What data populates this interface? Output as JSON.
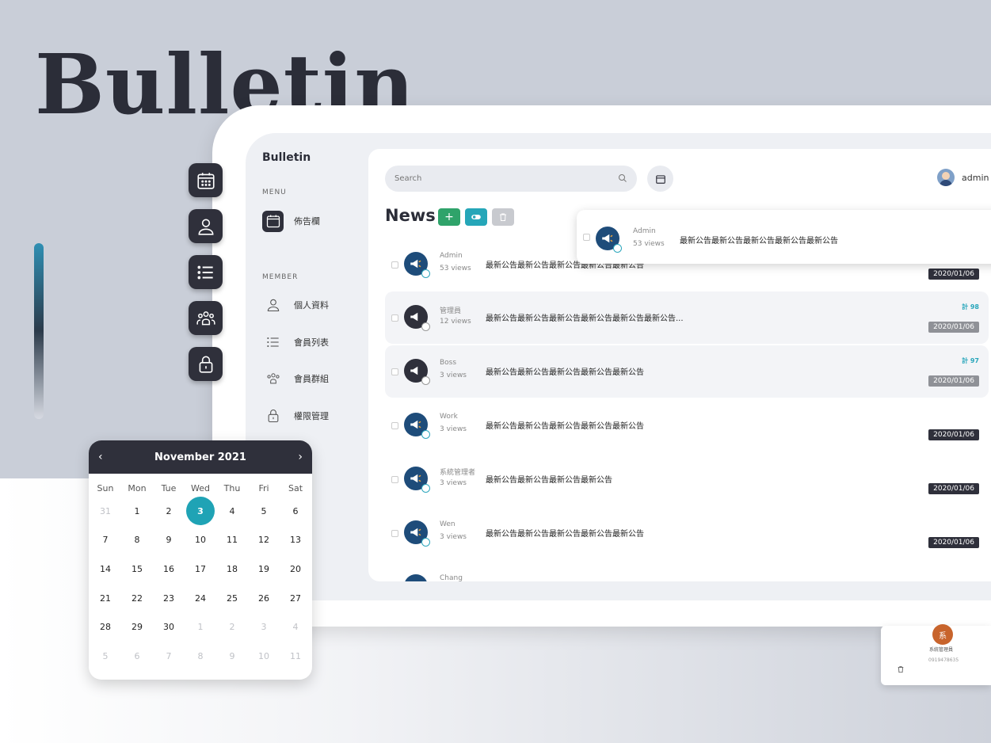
{
  "hero": {
    "title": "Bulletin"
  },
  "sidebar": {
    "brand": "Bulletin",
    "menu_label": "MENU",
    "menu_items": [
      {
        "label": "佈告欄",
        "icon": "calendar-icon"
      }
    ],
    "member_label": "MEMBER",
    "member_items": [
      {
        "label": "個人資料",
        "icon": "user-icon"
      },
      {
        "label": "會員列表",
        "icon": "list-icon"
      },
      {
        "label": "會員群組",
        "icon": "group-icon"
      },
      {
        "label": "權限管理",
        "icon": "lock-icon"
      }
    ]
  },
  "topbar": {
    "search_placeholder": "Search",
    "user_name": "admin"
  },
  "news": {
    "title": "News",
    "popup": {
      "author": "Admin",
      "views": "53 views",
      "message": "最新公告最新公告最新公告最新公告最新公告"
    },
    "rows": [
      {
        "author": "Admin",
        "views": "53 views",
        "message": "最新公告最新公告最新公告最新公告最新公告",
        "date": "2020/01/06",
        "count": ""
      },
      {
        "author": "管理員",
        "views": "12 views",
        "message": "最新公告最新公告最新公告最新公告最新公告最新公告...",
        "date": "2020/01/06",
        "count": "計 98"
      },
      {
        "author": "Boss",
        "views": "3 views",
        "message": "最新公告最新公告最新公告最新公告最新公告",
        "date": "2020/01/06",
        "count": "計 97"
      },
      {
        "author": "Work",
        "views": "3 views",
        "message": "最新公告最新公告最新公告最新公告最新公告",
        "date": "2020/01/06",
        "count": ""
      },
      {
        "author": "系統管理者",
        "views": "3 views",
        "message": "最新公告最新公告最新公告最新公告",
        "date": "2020/01/06",
        "count": ""
      },
      {
        "author": "Wen",
        "views": "3 views",
        "message": "最新公告最新公告最新公告最新公告最新公告",
        "date": "2020/01/06",
        "count": ""
      },
      {
        "author": "Chang",
        "views": "",
        "message": "",
        "date": "",
        "count": ""
      }
    ]
  },
  "calendar": {
    "month": "November",
    "year": "2021",
    "weekdays": [
      "Sun",
      "Mon",
      "Tue",
      "Wed",
      "Thu",
      "Fri",
      "Sat"
    ],
    "days": [
      "31",
      "1",
      "2",
      "3",
      "4",
      "5",
      "6",
      "7",
      "8",
      "9",
      "10",
      "11",
      "12",
      "13",
      "14",
      "15",
      "16",
      "17",
      "18",
      "19",
      "20",
      "21",
      "22",
      "23",
      "24",
      "25",
      "26",
      "27",
      "28",
      "29",
      "30",
      "1",
      "2",
      "3",
      "4",
      "5",
      "6",
      "7",
      "8",
      "9",
      "10",
      "11"
    ],
    "selected": "3"
  },
  "contact_card": {
    "avatar": "系",
    "name": "系統管理員",
    "phone": "0919478635"
  },
  "colors": {
    "accent": "#1fa3b5",
    "dark": "#2f303b",
    "add": "#2fa36a"
  }
}
